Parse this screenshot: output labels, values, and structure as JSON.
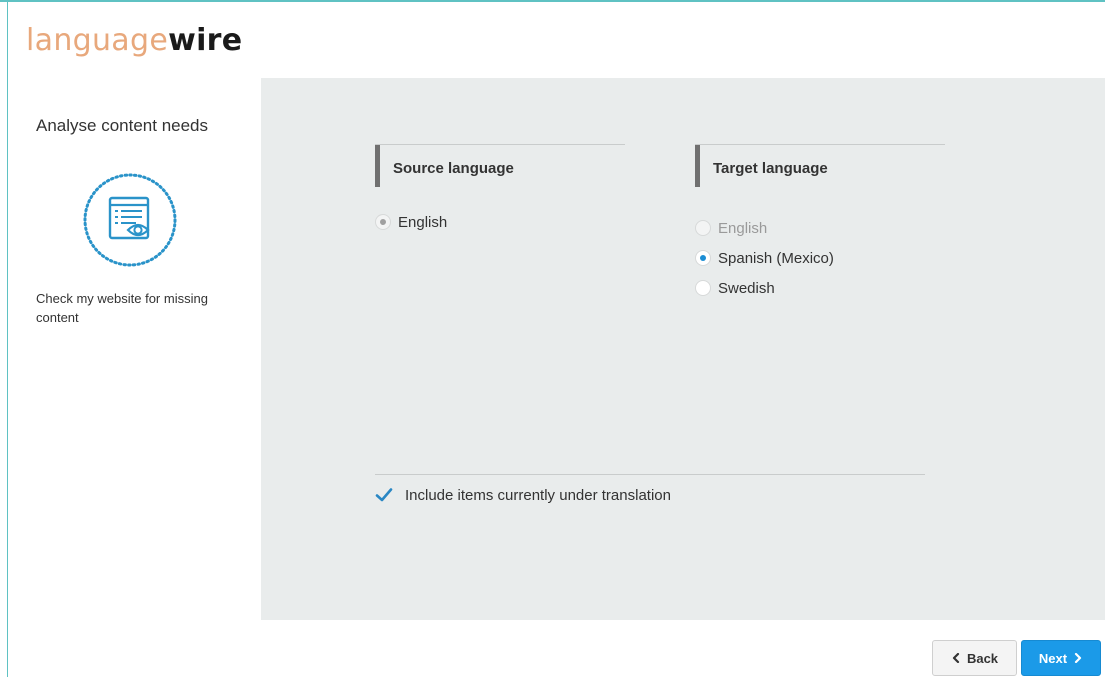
{
  "brand": {
    "part1": "language",
    "part2": "wire"
  },
  "sidebar": {
    "title": "Analyse content needs",
    "icon": "website-eye-icon",
    "description": "Check my website for missing content"
  },
  "source": {
    "heading": "Source language",
    "options": [
      {
        "label": "English",
        "checked": true,
        "disabled": true
      }
    ]
  },
  "target": {
    "heading": "Target language",
    "options": [
      {
        "label": "English",
        "checked": false,
        "disabled": true
      },
      {
        "label": "Spanish (Mexico)",
        "checked": true,
        "disabled": false
      },
      {
        "label": "Swedish",
        "checked": false,
        "disabled": false
      }
    ]
  },
  "include_option": {
    "label": "Include items currently under translation",
    "checked": true
  },
  "buttons": {
    "back": "Back",
    "next": "Next"
  },
  "colors": {
    "accent": "#1b9ae8",
    "brand_orange": "#e8a87c",
    "icon_teal": "#2a93c9",
    "panel": "#e9ecec"
  }
}
